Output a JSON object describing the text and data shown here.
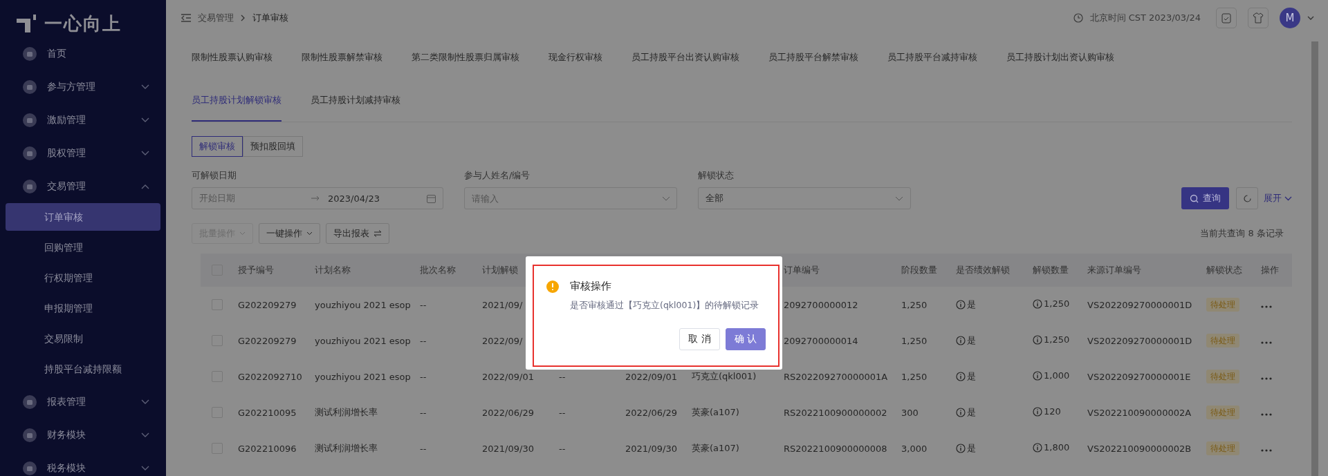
{
  "sidebar": {
    "logo": "一心向上",
    "items": [
      {
        "label": "首页",
        "kind": "link"
      },
      {
        "label": "参与方管理",
        "kind": "group",
        "expanded": false
      },
      {
        "label": "激励管理",
        "kind": "group",
        "expanded": false
      },
      {
        "label": "股权管理",
        "kind": "group",
        "expanded": false
      },
      {
        "label": "交易管理",
        "kind": "group",
        "expanded": true,
        "children": [
          {
            "label": "订单审核",
            "selected": true
          },
          {
            "label": "回购管理",
            "selected": false
          },
          {
            "label": "行权期管理",
            "selected": false
          },
          {
            "label": "申报期管理",
            "selected": false
          },
          {
            "label": "交易限制",
            "selected": false
          },
          {
            "label": "持股平台减持限额",
            "selected": false
          }
        ]
      },
      {
        "label": "报表管理",
        "kind": "group",
        "expanded": false
      },
      {
        "label": "财务模块",
        "kind": "group",
        "expanded": false
      },
      {
        "label": "税务模块",
        "kind": "group",
        "expanded": false
      }
    ]
  },
  "header": {
    "breadcrumb": [
      "交易管理",
      "订单审核"
    ],
    "time": "北京时间 CST 2023/03/24",
    "avatar": "M"
  },
  "tab_rows": [
    [
      {
        "label": "限制性股票认购审核",
        "selected": false
      },
      {
        "label": "限制性股票解禁审核",
        "selected": false
      },
      {
        "label": "第二类限制性股票归属审核",
        "selected": false
      },
      {
        "label": "现金行权审核",
        "selected": false
      },
      {
        "label": "员工持股平台出资认购审核",
        "selected": false
      },
      {
        "label": "员工持股平台解禁审核",
        "selected": false
      },
      {
        "label": "员工持股平台减持审核",
        "selected": false
      },
      {
        "label": "员工持股计划出资认购审核",
        "selected": false
      }
    ],
    [
      {
        "label": "员工持股计划解锁审核",
        "selected": true
      },
      {
        "label": "员工持股计划减持审核",
        "selected": false
      }
    ]
  ],
  "segments": [
    {
      "label": "解锁审核",
      "selected": true
    },
    {
      "label": "预扣股回填",
      "selected": false
    }
  ],
  "filters": {
    "date": {
      "label": "可解锁日期",
      "start_placeholder": "开始日期",
      "end_value": "2023/04/23"
    },
    "participant": {
      "label": "参与人姓名/编号",
      "placeholder": "请输入"
    },
    "status": {
      "label": "解锁状态",
      "value": "全部"
    },
    "search_button": "查询",
    "expand_button": "展开"
  },
  "actions": [
    {
      "label": "批量操作",
      "kind": "dropdown",
      "disabled": true
    },
    {
      "label": "一键操作",
      "kind": "dropdown",
      "disabled": false
    },
    {
      "label": "导出报表",
      "kind": "export",
      "disabled": false
    }
  ],
  "record_count": "当前共查询 8 条记录",
  "table": {
    "all_checked": false,
    "columns": [
      "授予编号",
      "计划名称",
      "批次名称",
      "计划解锁",
      null,
      null,
      null,
      "订单编号",
      "阶段数量",
      "是否绩效解锁",
      "解锁数量",
      "来源订单编号",
      "解锁状态",
      "操作"
    ],
    "rows": [
      {
        "checked": false,
        "cells": [
          "G202209279",
          "youzhiyou 2021 esop",
          "--",
          "2021/09/",
          null,
          null,
          null,
          "2092700000012",
          "1,250",
          "是",
          "1,250",
          "VS202209270000001D",
          "待处理"
        ]
      },
      {
        "checked": false,
        "cells": [
          "G202209279",
          "youzhiyou 2021 esop",
          "--",
          "2022/09/",
          null,
          null,
          null,
          "2092700000014",
          "1,250",
          "是",
          "1,250",
          "VS202209270000001D",
          "待处理"
        ]
      },
      {
        "checked": false,
        "cells": [
          "G2022092710",
          "youzhiyou 2021 esop",
          "--",
          "2022/09/01",
          "--",
          "2022/09/01",
          "巧克立(qkl001)",
          "RS202209270000001A",
          "1,250",
          "是",
          "1,000",
          "VS202209270000001E",
          "待处理"
        ]
      },
      {
        "checked": false,
        "cells": [
          "G202210095",
          "测试利润增长率",
          "--",
          "2022/06/29",
          "--",
          "2022/06/29",
          "英豪(a107)",
          "RS2022100900000002",
          "300",
          "是",
          "120",
          "VS202210090000002A",
          "待处理"
        ]
      },
      {
        "checked": false,
        "cells": [
          "G202210096",
          "测试利润增长率",
          "--",
          "2021/09/30",
          "--",
          "2021/09/30",
          "英豪(a107)",
          "RS2022100900000008",
          "3,000",
          "是",
          "1,800",
          "VS202210090000002B",
          "待处理"
        ]
      }
    ]
  },
  "dialog": {
    "title": "审核操作",
    "message": "是否审核通过【巧克立(qkl001)】的待解锁记录",
    "buttons": [
      {
        "label": "取 消",
        "kind": "secondary"
      },
      {
        "label": "确 认",
        "kind": "primary"
      }
    ]
  }
}
